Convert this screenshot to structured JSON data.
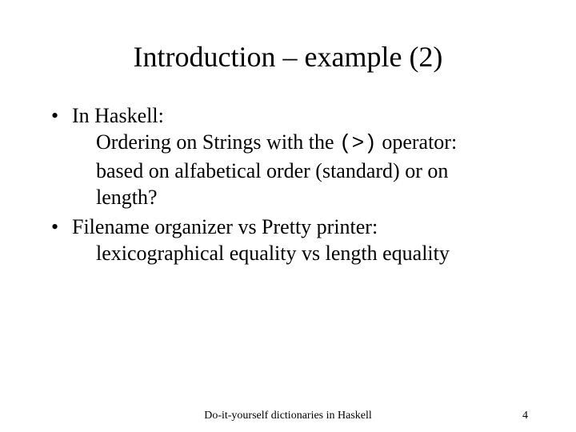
{
  "title": "Introduction – example (2)",
  "bullets": [
    {
      "lead": "In Haskell:",
      "line2_pre": "Ordering on Strings with the ",
      "op": "(>)",
      "line2_post": " operator:",
      "line3": "based on alfabetical order (standard) or on",
      "line4": "length?"
    },
    {
      "lead": "Filename organizer vs Pretty printer:",
      "line2": "lexicographical equality vs length equality"
    }
  ],
  "footer": {
    "center": "Do-it-yourself dictionaries in Haskell",
    "page": "4"
  }
}
